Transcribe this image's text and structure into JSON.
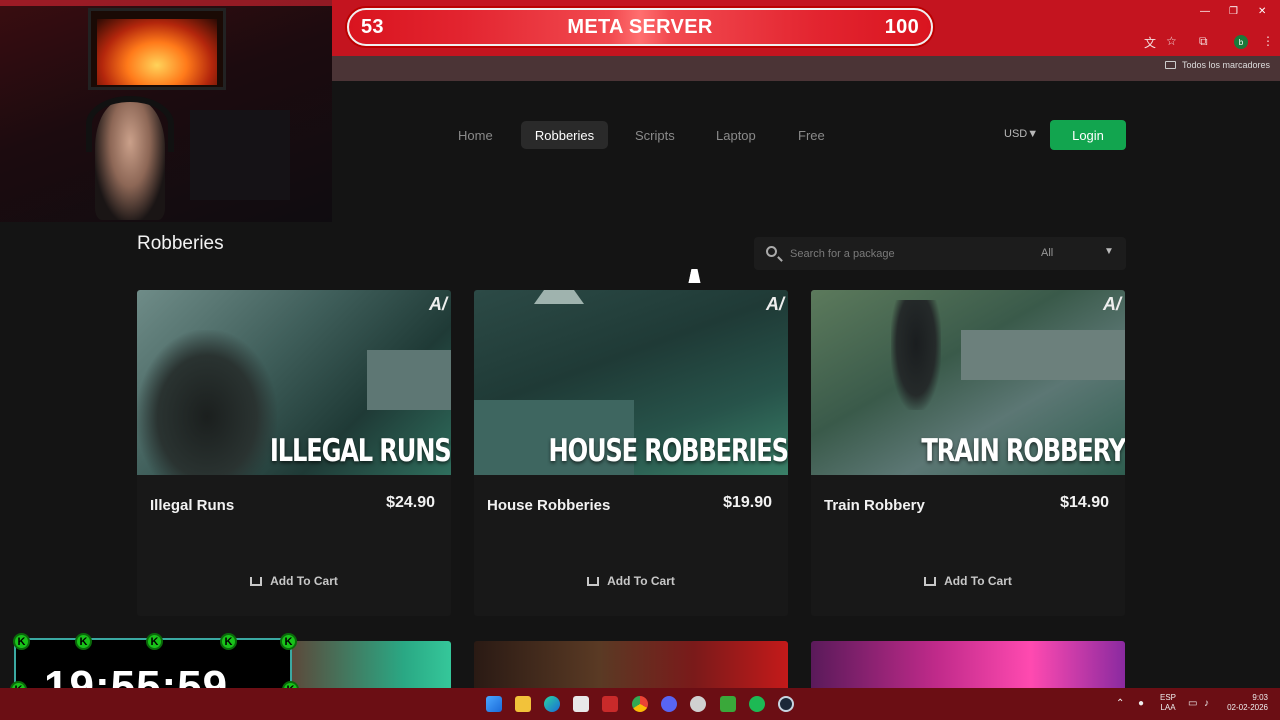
{
  "overlay": {
    "score_left": "53",
    "title": "META SERVER",
    "score_right": "100",
    "timer": "19:55:59",
    "timer_badge": "K"
  },
  "browser": {
    "bookmarks_label": "Todos los marcadores",
    "profile_initial": "b"
  },
  "nav": {
    "items": [
      {
        "label": "Home"
      },
      {
        "label": "Robberies"
      },
      {
        "label": "Scripts"
      },
      {
        "label": "Laptop"
      },
      {
        "label": "Free"
      }
    ],
    "currency": "USD▼",
    "login_label": "Login"
  },
  "main": {
    "title": "Robberies",
    "search_placeholder": "Search for a package",
    "filter_value": "All",
    "products": [
      {
        "thumb_text": "ILLEGAL RUNS",
        "name": "Illegal Runs",
        "price": "$24.90",
        "cart_label": "Add To Cart",
        "brand": "A/"
      },
      {
        "thumb_text": "HOUSE ROBBERIES",
        "name": "House Robberies",
        "price": "$19.90",
        "cart_label": "Add To Cart",
        "brand": "A/"
      },
      {
        "thumb_text": "TRAIN ROBBERY",
        "name": "Train Robbery",
        "price": "$14.90",
        "cart_label": "Add To Cart",
        "brand": "A/"
      }
    ]
  },
  "taskbar": {
    "lang_line1": "ESP",
    "lang_line2": "LAA",
    "time": "9:03",
    "date": "02-02-2026"
  },
  "colors": {
    "accent_green": "#12a54f",
    "browser_red": "#c4141f",
    "taskbar": "#6b0e14"
  }
}
